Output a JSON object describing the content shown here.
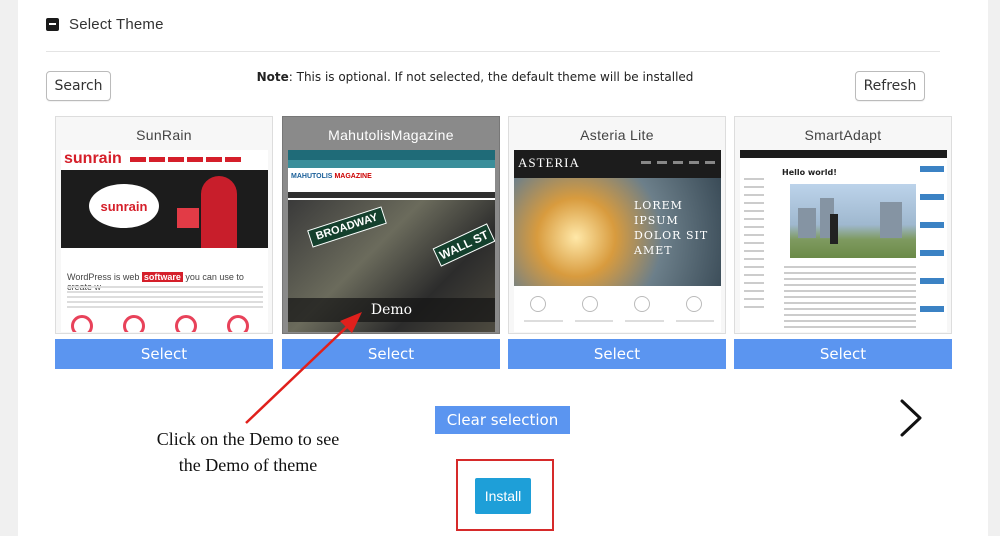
{
  "section": {
    "title": "Select Theme",
    "collapse_icon": "minus-square-icon"
  },
  "toolbar": {
    "search_label": "Search",
    "refresh_label": "Refresh",
    "note_label": "Note",
    "note_text": ": This is optional. If not selected, the default theme will be installed"
  },
  "themes": [
    {
      "name": "SunRain",
      "select_label": "Select",
      "thumb": {
        "logo": "sunrain",
        "badge": "sunrain",
        "headline_prefix": "WordPress is web ",
        "headline_highlight": "software",
        "headline_suffix": " you can use to create w"
      }
    },
    {
      "name": "MahutolisMagazine",
      "select_label": "Select",
      "demo_label": "Demo",
      "thumb": {
        "brand_a": "MAHUTOLIS",
        "brand_b": "MAGAZINE",
        "sign_a": "BROADWAY",
        "sign_b": "WALL ST"
      }
    },
    {
      "name": "Asteria Lite",
      "select_label": "Select",
      "thumb": {
        "logo": "ASTERIA",
        "hero_lines": [
          "LOREM",
          "IPSUM",
          "DOLOR SIT",
          "AMET"
        ]
      }
    },
    {
      "name": "SmartAdapt",
      "select_label": "Select",
      "thumb": {
        "post_title": "Hello world!"
      }
    }
  ],
  "clear_label": "Clear selection",
  "next_icon": "chevron-right-icon",
  "install_label": "Install",
  "annotation": {
    "line1": "Click on the Demo to see",
    "line2": "the Demo of theme"
  },
  "colors": {
    "accent": "#5b95f0",
    "install": "#1e9fd8",
    "highlight_red": "#d62a2a"
  }
}
